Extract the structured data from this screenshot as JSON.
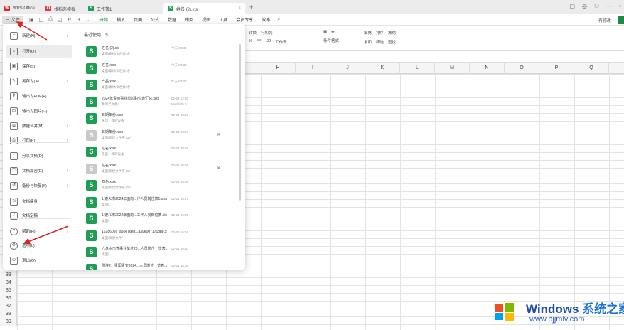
{
  "titlebar": {
    "tabs": [
      {
        "label": "WPS Office",
        "icon": "wps-logo-icon"
      },
      {
        "label": "找稻壳模板",
        "icon": "docer-icon"
      },
      {
        "label": "工作簿1",
        "icon": "sheet-icon"
      },
      {
        "label": "姓名 (2).xls",
        "icon": "sheet-icon",
        "active": true
      }
    ],
    "new_tab": "+"
  },
  "menubar": {
    "file_label": "三 文件",
    "menus": [
      "开始",
      "插入",
      "页面",
      "公式",
      "数据",
      "审阅",
      "视图",
      "工具",
      "会员专享",
      "效率"
    ],
    "active_menu": "开始",
    "collab_label": "有修改"
  },
  "ribbon": {
    "row1": [
      "转换",
      "行和列",
      "填充",
      "排序",
      "冻结"
    ],
    "row2": [
      "工作表",
      "条件格式",
      "求和",
      "筛选",
      "查找"
    ]
  },
  "columns": [
    "H",
    "I",
    "J",
    "K",
    "L",
    "M",
    "N",
    "O",
    "P",
    "Q"
  ],
  "rows": [
    "33",
    "34",
    "35",
    "36",
    "37",
    "38",
    "39"
  ],
  "file_menu": {
    "items": [
      {
        "label": "新建(N)",
        "icon": "new-doc-icon",
        "arrow": true
      },
      {
        "label": "打开(O)",
        "icon": "folder-open-icon",
        "arrow": false
      },
      {
        "label": "保存(S)",
        "icon": "save-icon",
        "arrow": false
      },
      {
        "label": "另存为(A)",
        "icon": "save-as-icon",
        "arrow": true
      },
      {
        "label": "输出为PDF(F)",
        "icon": "pdf-icon",
        "arrow": false
      },
      {
        "label": "输出为图片(G)",
        "icon": "image-export-icon",
        "arrow": false
      },
      {
        "label": "数据合并(M)",
        "icon": "merge-icon",
        "arrow": true
      },
      {
        "label": "打印(P)",
        "icon": "print-icon",
        "arrow": true
      },
      {
        "label": "分享文档(D)",
        "icon": "share-icon",
        "arrow": false
      },
      {
        "label": "文档加密(E)",
        "icon": "lock-doc-icon",
        "arrow": true
      },
      {
        "label": "备份与恢复(K)",
        "icon": "backup-icon",
        "arrow": true
      },
      {
        "label": "文档瘦身",
        "icon": "slim-icon",
        "arrow": false
      },
      {
        "label": "文档定稿",
        "icon": "finalize-icon",
        "arrow": false
      },
      {
        "label": "帮助(H)",
        "icon": "help-icon",
        "arrow": true
      },
      {
        "label": "选项(L)",
        "icon": "options-icon",
        "arrow": false
      },
      {
        "label": "退出(Q)",
        "icon": "exit-icon",
        "arrow": false
      }
    ],
    "recent_title": "最近使用",
    "recent_files": [
      {
        "name": "姓名 (2).xls",
        "path": "桌面/素材/文档素材/",
        "time": "今天 08:33",
        "time2": "",
        "gray": false,
        "closable": false
      },
      {
        "name": "姓名.xlsx",
        "path": "桌面/素材/文档素材/",
        "time": "今天 08:33",
        "time2": "",
        "gray": false,
        "closable": false
      },
      {
        "name": "产品.xlsx",
        "path": "桌面/素材/文档素材/",
        "time": "昨天 08:30",
        "time2": "",
        "gray": false,
        "closable": false
      },
      {
        "name": "2024年贵州事业单位职位表汇总.xlsx",
        "path": "我的云文档/",
        "time": "02-24 12:20",
        "time2": "Mozilla/5.0 (...",
        "gray": false,
        "closable": false
      },
      {
        "name": "日期年份.xlsx",
        "path": "来自：我的设备",
        "time": "02-23 08:57",
        "time2": "",
        "gray": false,
        "closable": false
      },
      {
        "name": "日期年份.xlsx",
        "path": "桌面/新建文件夹 (3)/",
        "time": "02-23 08:57",
        "time2": "",
        "gray": true,
        "closable": true
      },
      {
        "name": "姓名.xlsx",
        "path": "来自：我的设备",
        "time": "02-23 08:56",
        "time2": "",
        "gray": false,
        "closable": false
      },
      {
        "name": "姓名.xlsx",
        "path": "桌面/新建文件夹 (3)/",
        "time": "02-23 08:56",
        "time2": "",
        "gray": true,
        "closable": true
      },
      {
        "name": "四色.xlsx",
        "path": "桌面/新建文件夹 (3)/",
        "time": "02-23 08:56",
        "time2": "",
        "gray": false,
        "closable": false
      },
      {
        "name": "1.遵义市2024年面向...作人员岗位表1.xlsx",
        "path": "桌面/",
        "time": "02-21 16:27",
        "time2": "",
        "gray": false,
        "closable": false
      },
      {
        "name": "1.遵义市2024年面向...工作人员岗位表.xlsx",
        "path": "桌面/",
        "time": "02-21 16:25",
        "time2": "",
        "gray": false,
        "closable": false
      },
      {
        "name": "16286066_a50e76eb...a39e0071718b8.xls",
        "path": "桌面/资源文件/",
        "time": "02-21 16:16",
        "time2": "",
        "gray": false,
        "closable": false
      },
      {
        "name": "六盘水市直事业单位20...人员岗位一览表.xls",
        "path": "桌面/",
        "time": "02-21 16:10",
        "time2": "",
        "gray": false,
        "closable": false
      },
      {
        "name": "附件2：贵阳贵安2024...人员岗位一览表.xlsx",
        "path": "",
        "time": "02-21 16:09",
        "time2": "",
        "gray": false,
        "closable": false
      }
    ]
  },
  "watermark": {
    "brand": "Windows",
    "brand_cn": "系统之家",
    "url": "www.bjjmlv.com"
  },
  "colors": {
    "accent": "#1e8a47",
    "file_icon": "#1e9e55",
    "annotation": "#e02020"
  }
}
